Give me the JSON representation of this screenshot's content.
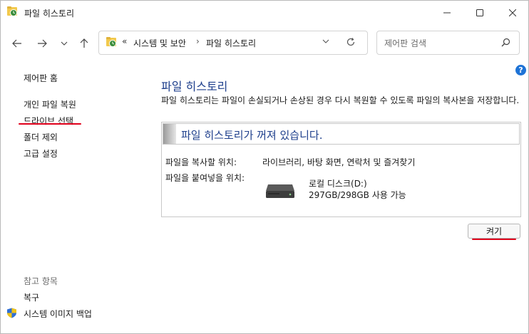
{
  "window": {
    "title": "파일 히스토리"
  },
  "address": {
    "overflow": "«",
    "crumbs": [
      "시스템 및 보안",
      "파일 히스토리"
    ],
    "separator": "›"
  },
  "search": {
    "placeholder": "제어판 검색"
  },
  "help_icon": "?",
  "sidebar": {
    "items": [
      {
        "label": "제어판 홈"
      },
      {
        "label": "개인 파일 복원"
      },
      {
        "label": "드라이브 선택"
      },
      {
        "label": "폴더 제외"
      },
      {
        "label": "고급 설정"
      }
    ],
    "see_also_label": "참고 항목",
    "see_also": [
      {
        "label": "복구"
      },
      {
        "label": "시스템 이미지 백업"
      }
    ]
  },
  "main": {
    "title": "파일 히스토리",
    "description": "파일 히스토리는 파일이 손실되거나 손상된 경우 다시 복원할 수 있도록 파일의 복사본을 저장합니다.",
    "status_header": "파일 히스토리가 꺼져 있습니다.",
    "copy_from_label": "파일을 복사할 위치:",
    "copy_from_value": "라이브러리, 바탕 화면, 연락처 및 즐겨찾기",
    "copy_to_label": "파일을 붙여넣을 위치:",
    "drive_name": "로컬 디스크(D:)",
    "drive_space": "297GB/298GB 사용 가능",
    "turn_on_button": "켜기"
  },
  "colors": {
    "accent_title": "#1e3f8c",
    "annotation_red": "#e0001b",
    "help_blue": "#1e73d6"
  }
}
